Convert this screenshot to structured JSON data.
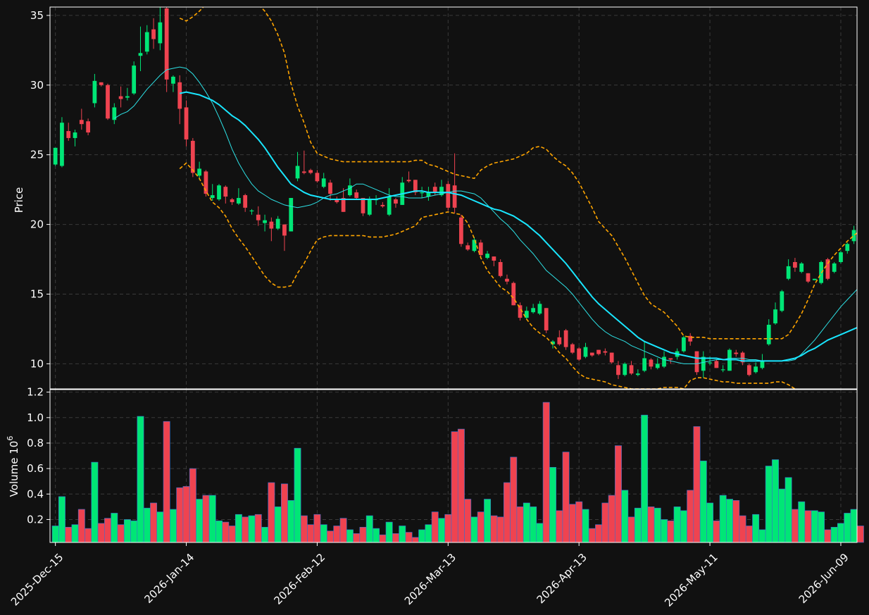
{
  "colors": {
    "background": "#111111",
    "frame": "#ffffff",
    "grid": "#3a3a3a",
    "up": "#00e676",
    "down": "#ef4350",
    "ma_short": "#2de2e6",
    "ma_long": "#19e6ff",
    "band": "#ffa500",
    "text": "#ffffff"
  },
  "chart_data": {
    "type": "candlestick",
    "grid": true,
    "price_panel": {
      "ylabel": "Price",
      "ylim": [
        8.2,
        35.6
      ],
      "yticks": [
        10,
        15,
        20,
        25,
        30,
        35
      ],
      "ytick_labels": [
        "10",
        "15",
        "20",
        "25",
        "30",
        "35"
      ]
    },
    "volume_panel": {
      "ylabel": "Volume  10",
      "ylabel_exponent": "6",
      "ylim": [
        0.02,
        1.22
      ],
      "yticks": [
        0.2,
        0.4,
        0.6,
        0.8,
        1.0,
        1.2
      ],
      "ytick_labels": [
        "0.2",
        "0.4",
        "0.6",
        "0.8",
        "1.0",
        "1.2"
      ]
    },
    "x_tick_labels": [
      "2025-Dec-15",
      "2026-Jan-14",
      "2026-Feb-12",
      "2026-Mar-13",
      "2026-Apr-13",
      "2026-May-11",
      "2026-Jun-09"
    ],
    "x_tick_index": [
      0,
      20,
      40,
      60,
      80,
      100,
      120
    ],
    "candles": [
      [
        24.3,
        25.5,
        24.2,
        25.5,
        0.15
      ],
      [
        24.2,
        27.3,
        24.1,
        27.7,
        0.38
      ],
      [
        26.7,
        26.2,
        26.0,
        27.3,
        0.14
      ],
      [
        26.2,
        26.6,
        25.6,
        26.8,
        0.16
      ],
      [
        27.5,
        27.2,
        26.8,
        28.3,
        0.28
      ],
      [
        27.4,
        26.6,
        26.4,
        27.6,
        0.13
      ],
      [
        28.7,
        30.3,
        28.4,
        30.8,
        0.65
      ],
      [
        30.2,
        30.0,
        29.9,
        30.2,
        0.17
      ],
      [
        30.0,
        27.6,
        27.5,
        30.1,
        0.21
      ],
      [
        27.5,
        28.4,
        27.2,
        28.7,
        0.25
      ],
      [
        29.2,
        29.0,
        28.4,
        29.9,
        0.16
      ],
      [
        29.1,
        29.2,
        28.9,
        29.8,
        0.2
      ],
      [
        29.4,
        31.4,
        29.3,
        31.7,
        0.19
      ],
      [
        32.1,
        32.3,
        31.0,
        34.2,
        1.01
      ],
      [
        32.4,
        33.8,
        32.2,
        34.3,
        0.29
      ],
      [
        34.0,
        33.3,
        32.6,
        34.8,
        0.33
      ],
      [
        33.0,
        34.5,
        32.5,
        35.6,
        0.26
      ],
      [
        35.5,
        30.4,
        29.5,
        35.8,
        0.97
      ],
      [
        30.1,
        30.6,
        29.5,
        30.7,
        0.28
      ],
      [
        30.2,
        28.3,
        27.2,
        30.7,
        0.45
      ],
      [
        28.4,
        26.1,
        25.6,
        28.9,
        0.46
      ],
      [
        26.0,
        23.7,
        23.4,
        26.2,
        0.6
      ],
      [
        23.5,
        24.0,
        23.2,
        24.5,
        0.36
      ],
      [
        23.8,
        22.2,
        22.0,
        23.9,
        0.39
      ],
      [
        21.9,
        22.1,
        21.7,
        22.9,
        0.39
      ],
      [
        21.8,
        22.8,
        21.7,
        22.9,
        0.19
      ],
      [
        22.7,
        22.0,
        21.5,
        22.8,
        0.18
      ],
      [
        21.8,
        21.6,
        21.4,
        21.9,
        0.15
      ],
      [
        21.5,
        21.9,
        21.4,
        22.6,
        0.24
      ],
      [
        22.1,
        21.2,
        20.9,
        22.2,
        0.22
      ],
      [
        21.0,
        21.0,
        20.7,
        21.1,
        0.23
      ],
      [
        20.7,
        20.3,
        19.9,
        21.3,
        0.24
      ],
      [
        20.1,
        20.3,
        19.5,
        20.7,
        0.14
      ],
      [
        20.2,
        19.7,
        18.8,
        20.5,
        0.49
      ],
      [
        19.7,
        20.4,
        19.6,
        20.6,
        0.3
      ],
      [
        20.0,
        19.2,
        18.1,
        20.0,
        0.48
      ],
      [
        19.5,
        21.9,
        19.5,
        21.9,
        0.35
      ],
      [
        23.3,
        24.2,
        23.1,
        25.2,
        0.76
      ],
      [
        23.8,
        23.7,
        23.6,
        25.3,
        0.23
      ],
      [
        23.9,
        23.7,
        23.6,
        24.0,
        0.16
      ],
      [
        23.7,
        23.1,
        23.0,
        23.9,
        0.24
      ],
      [
        22.7,
        23.3,
        22.6,
        23.7,
        0.16
      ],
      [
        23.0,
        22.2,
        21.7,
        23.2,
        0.11
      ],
      [
        21.8,
        21.6,
        21.5,
        22.0,
        0.15
      ],
      [
        21.9,
        20.9,
        20.9,
        22.6,
        0.21
      ],
      [
        22.1,
        22.8,
        22.0,
        23.3,
        0.12
      ],
      [
        22.3,
        21.9,
        21.8,
        22.5,
        0.09
      ],
      [
        21.9,
        20.8,
        20.6,
        21.9,
        0.14
      ],
      [
        20.7,
        21.8,
        20.6,
        22.0,
        0.23
      ],
      [
        21.8,
        21.8,
        21.4,
        22.1,
        0.13
      ],
      [
        21.4,
        21.3,
        21.2,
        21.6,
        0.08
      ],
      [
        20.7,
        22.0,
        20.6,
        22.6,
        0.18
      ],
      [
        21.8,
        21.5,
        21.2,
        21.9,
        0.09
      ],
      [
        21.4,
        23.0,
        21.4,
        23.4,
        0.15
      ],
      [
        23.2,
        23.1,
        23.0,
        23.8,
        0.1
      ],
      [
        23.2,
        22.3,
        22.1,
        23.2,
        0.06
      ],
      [
        22.3,
        22.3,
        21.9,
        22.7,
        0.12
      ],
      [
        22.0,
        22.3,
        21.7,
        22.7,
        0.16
      ],
      [
        22.7,
        22.3,
        22.1,
        23.0,
        0.26
      ],
      [
        22.1,
        22.7,
        22.0,
        23.2,
        0.21
      ],
      [
        22.9,
        21.2,
        21.0,
        23.1,
        0.24
      ],
      [
        22.8,
        21.2,
        20.8,
        25.1,
        0.89
      ],
      [
        20.5,
        18.6,
        18.4,
        20.7,
        0.91
      ],
      [
        18.5,
        18.2,
        18.1,
        18.7,
        0.36
      ],
      [
        18.1,
        18.9,
        18.0,
        19.1,
        0.22
      ],
      [
        18.7,
        17.8,
        17.6,
        18.9,
        0.26
      ],
      [
        17.6,
        17.9,
        17.5,
        18.1,
        0.36
      ],
      [
        17.7,
        17.4,
        17.0,
        17.7,
        0.23
      ],
      [
        17.3,
        16.3,
        16.2,
        17.5,
        0.22
      ],
      [
        16.1,
        15.9,
        15.7,
        16.4,
        0.49
      ],
      [
        15.8,
        14.2,
        14.2,
        15.9,
        0.69
      ],
      [
        14.2,
        13.3,
        13.1,
        14.4,
        0.3
      ],
      [
        13.3,
        13.8,
        13.2,
        14.1,
        0.33
      ],
      [
        13.7,
        14.0,
        13.6,
        14.3,
        0.3
      ],
      [
        13.6,
        14.3,
        13.5,
        14.5,
        0.17
      ],
      [
        14.0,
        12.4,
        12.2,
        14.0,
        1.12
      ],
      [
        11.4,
        11.6,
        11.1,
        11.7,
        0.61
      ],
      [
        11.9,
        11.4,
        11.3,
        12.4,
        0.27
      ],
      [
        12.4,
        11.2,
        11.0,
        12.5,
        0.73
      ],
      [
        11.4,
        10.8,
        10.7,
        11.5,
        0.32
      ],
      [
        11.1,
        10.3,
        10.2,
        11.2,
        0.34
      ],
      [
        10.5,
        11.2,
        10.4,
        11.5,
        0.28
      ],
      [
        10.8,
        10.6,
        10.5,
        10.8,
        0.13
      ],
      [
        11.0,
        10.7,
        10.6,
        11.0,
        0.16
      ],
      [
        10.9,
        10.8,
        10.6,
        11.1,
        0.33
      ],
      [
        10.8,
        10.1,
        10.0,
        10.8,
        0.39
      ],
      [
        9.9,
        9.2,
        8.9,
        10.2,
        0.78
      ],
      [
        9.2,
        10.0,
        9.1,
        10.1,
        0.43
      ],
      [
        9.9,
        9.3,
        9.2,
        10.2,
        0.22
      ],
      [
        9.2,
        9.3,
        9.1,
        9.6,
        0.29
      ],
      [
        9.5,
        10.4,
        9.4,
        11.6,
        1.02
      ],
      [
        10.3,
        9.8,
        9.6,
        10.4,
        0.3
      ],
      [
        9.7,
        10.0,
        9.6,
        10.4,
        0.29
      ],
      [
        9.8,
        10.5,
        9.7,
        10.9,
        0.2
      ],
      [
        10.4,
        10.3,
        10.0,
        10.4,
        0.19
      ],
      [
        10.5,
        10.9,
        10.3,
        11.1,
        0.3
      ],
      [
        10.9,
        11.9,
        10.8,
        12.0,
        0.27
      ],
      [
        12.0,
        11.6,
        11.3,
        12.2,
        0.43
      ],
      [
        10.9,
        9.4,
        9.2,
        10.9,
        0.93
      ],
      [
        9.5,
        10.5,
        9.0,
        10.9,
        0.66
      ],
      [
        10.1,
        10.1,
        9.9,
        10.5,
        0.33
      ],
      [
        10.2,
        9.7,
        9.7,
        10.3,
        0.19
      ],
      [
        9.6,
        9.6,
        9.4,
        9.9,
        0.39
      ],
      [
        9.5,
        11.0,
        9.5,
        11.1,
        0.36
      ],
      [
        10.8,
        10.7,
        10.5,
        11.0,
        0.35
      ],
      [
        10.8,
        10.1,
        9.9,
        10.9,
        0.23
      ],
      [
        9.9,
        9.2,
        9.1,
        10.0,
        0.15
      ],
      [
        9.4,
        9.8,
        9.3,
        10.1,
        0.24
      ],
      [
        9.7,
        10.2,
        9.6,
        10.7,
        0.12
      ],
      [
        11.4,
        12.8,
        11.3,
        13.2,
        0.62
      ],
      [
        12.9,
        13.9,
        12.8,
        14.4,
        0.67
      ],
      [
        13.8,
        15.2,
        13.7,
        15.3,
        0.44
      ],
      [
        16.1,
        17.0,
        16.0,
        17.5,
        0.53
      ],
      [
        17.3,
        16.9,
        16.6,
        17.6,
        0.28
      ],
      [
        16.6,
        17.2,
        16.5,
        17.3,
        0.34
      ],
      [
        16.5,
        15.9,
        15.8,
        16.5,
        0.27
      ],
      [
        16.0,
        16.1,
        16.0,
        16.1,
        0.27
      ],
      [
        15.8,
        17.3,
        15.7,
        17.4,
        0.26
      ],
      [
        17.5,
        16.1,
        16.0,
        17.6,
        0.12
      ],
      [
        16.6,
        17.2,
        16.5,
        17.3,
        0.14
      ],
      [
        17.3,
        18.0,
        17.2,
        18.1,
        0.17
      ],
      [
        18.1,
        18.6,
        17.9,
        18.7,
        0.25
      ],
      [
        18.8,
        19.6,
        18.6,
        19.9,
        0.28
      ],
      [
        19.7,
        18.5,
        18.2,
        19.8,
        0.15
      ]
    ],
    "series": [
      {
        "style": "thin",
        "start_index": 9,
        "values": [
          27.6,
          27.9,
          28.1,
          28.5,
          29.1,
          29.7,
          30.2,
          30.7,
          31.1,
          31.2,
          31.3,
          31.2,
          30.8,
          30.2,
          29.5,
          28.7,
          27.7,
          26.6,
          25.4,
          24.4,
          23.6,
          22.9,
          22.4,
          22.1,
          21.8,
          21.6,
          21.4,
          21.3,
          21.2,
          21.3,
          21.4,
          21.6,
          21.9,
          22.1,
          22.2,
          22.4,
          22.6,
          22.9,
          22.9,
          22.7,
          22.5,
          22.3,
          22.1,
          22.0,
          22.0,
          21.9,
          21.9,
          21.9,
          22.0,
          22.1,
          22.2,
          22.3,
          22.4,
          22.4,
          22.3,
          22.2,
          21.9,
          21.4,
          20.9,
          20.4,
          20.0,
          19.5,
          18.9,
          18.4,
          17.9,
          17.3,
          16.7,
          16.3,
          15.9,
          15.5,
          15.0,
          14.4,
          13.8,
          13.2,
          12.7,
          12.3,
          12.0,
          11.8,
          11.6,
          11.3,
          11.1,
          10.9,
          10.7,
          10.5,
          10.3,
          10.2,
          10.1,
          10.0,
          10.0,
          10.0,
          10.1,
          10.2,
          10.3,
          10.3,
          10.4,
          10.4,
          10.4,
          10.3,
          10.3,
          10.2,
          10.2,
          10.2,
          10.2,
          10.2,
          10.3,
          10.7,
          11.2,
          11.7,
          12.3,
          12.9,
          13.5,
          14.1,
          14.6,
          15.1,
          15.6,
          16.1,
          16.5,
          16.8,
          17.0,
          17.2,
          17.3,
          17.4
        ]
      },
      {
        "style": "thick",
        "start_index": 19,
        "values": [
          29.4,
          29.5,
          29.4,
          29.3,
          29.1,
          28.9,
          28.6,
          28.2,
          27.8,
          27.5,
          27.1,
          26.6,
          26.1,
          25.5,
          24.8,
          24.1,
          23.5,
          22.9,
          22.6,
          22.3,
          22.1,
          22.0,
          21.9,
          21.8,
          21.8,
          21.8,
          21.8,
          21.8,
          21.8,
          21.8,
          21.8,
          21.9,
          22.0,
          22.1,
          22.2,
          22.3,
          22.4,
          22.4,
          22.3,
          22.3,
          22.3,
          22.3,
          22.2,
          22.1,
          21.9,
          21.7,
          21.5,
          21.3,
          21.1,
          21.0,
          20.8,
          20.6,
          20.3,
          20.0,
          19.6,
          19.2,
          18.7,
          18.2,
          17.7,
          17.2,
          16.6,
          16.0,
          15.4,
          14.8,
          14.3,
          13.9,
          13.5,
          13.1,
          12.7,
          12.3,
          11.9,
          11.6,
          11.4,
          11.2,
          11.0,
          10.8,
          10.7,
          10.6,
          10.5,
          10.4,
          10.4,
          10.4,
          10.4,
          10.3,
          10.3,
          10.3,
          10.2,
          10.2,
          10.2,
          10.2,
          10.2,
          10.2,
          10.2,
          10.3,
          10.4,
          10.6,
          10.9,
          11.1,
          11.4,
          11.7,
          11.9,
          12.1,
          12.3,
          12.5,
          12.7,
          12.9,
          13.2,
          13.5,
          13.8,
          14.1,
          14.5,
          14.8,
          15.1
        ]
      },
      {
        "style": "dashed",
        "start_index": 19,
        "values": [
          34.8,
          34.6,
          34.9,
          35.3,
          35.8,
          36.2,
          36.6,
          37.0,
          37.3,
          37.1,
          36.8,
          36.3,
          35.8,
          35.3,
          34.6,
          33.6,
          32.3,
          30.1,
          28.5,
          27.3,
          25.9,
          25.1,
          24.9,
          24.7,
          24.6,
          24.5,
          24.5,
          24.5,
          24.5,
          24.5,
          24.5,
          24.5,
          24.5,
          24.5,
          24.5,
          24.5,
          24.6,
          24.6,
          24.3,
          24.2,
          24.0,
          23.8,
          23.6,
          23.5,
          23.4,
          23.3,
          23.9,
          24.2,
          24.4,
          24.5,
          24.6,
          24.7,
          24.9,
          25.1,
          25.5,
          25.6,
          25.4,
          24.9,
          24.5,
          24.2,
          23.7,
          23.0,
          22.1,
          21.2,
          20.2,
          19.7,
          19.2,
          18.4,
          17.6,
          16.7,
          15.8,
          14.9,
          14.3,
          14.0,
          13.7,
          13.2,
          12.7,
          12.0,
          11.9,
          11.9,
          11.9,
          11.8,
          11.8,
          11.8,
          11.8,
          11.8,
          11.8,
          11.8,
          11.8,
          11.8,
          11.8,
          11.8,
          11.8,
          12.1,
          12.8,
          13.6,
          14.6,
          15.7,
          16.5,
          17.2,
          17.8,
          18.3,
          18.8,
          19.2,
          19.6,
          20.1,
          20.6,
          21.1,
          21.5
        ]
      },
      {
        "style": "dashed",
        "start_index": 19,
        "values": [
          24.0,
          24.4,
          23.9,
          23.3,
          22.4,
          21.6,
          21.2,
          20.6,
          19.7,
          19.0,
          18.4,
          17.7,
          17.0,
          16.3,
          15.8,
          15.5,
          15.5,
          15.6,
          16.5,
          17.2,
          18.1,
          18.9,
          19.1,
          19.2,
          19.2,
          19.2,
          19.2,
          19.2,
          19.2,
          19.1,
          19.1,
          19.1,
          19.2,
          19.3,
          19.5,
          19.7,
          19.9,
          20.5,
          20.6,
          20.7,
          20.8,
          20.9,
          20.8,
          20.7,
          20.1,
          19.0,
          17.6,
          16.7,
          16.1,
          15.5,
          15.2,
          14.7,
          14.0,
          13.2,
          12.6,
          12.2,
          11.9,
          11.4,
          10.8,
          10.4,
          9.8,
          9.3,
          9.0,
          8.9,
          8.8,
          8.7,
          8.5,
          8.4,
          8.3,
          8.2,
          8.2,
          8.2,
          8.2,
          8.2,
          8.3,
          8.3,
          8.3,
          8.2,
          8.8,
          9.0,
          9.0,
          8.9,
          8.8,
          8.7,
          8.7,
          8.6,
          8.6,
          8.6,
          8.6,
          8.6,
          8.6,
          8.7,
          8.7,
          8.5,
          8.2,
          7.7,
          7.2,
          6.8,
          6.5,
          6.3,
          6.2,
          6.3,
          6.5,
          6.9,
          7.3,
          7.8,
          8.0,
          8.2,
          8.5
        ]
      }
    ]
  }
}
